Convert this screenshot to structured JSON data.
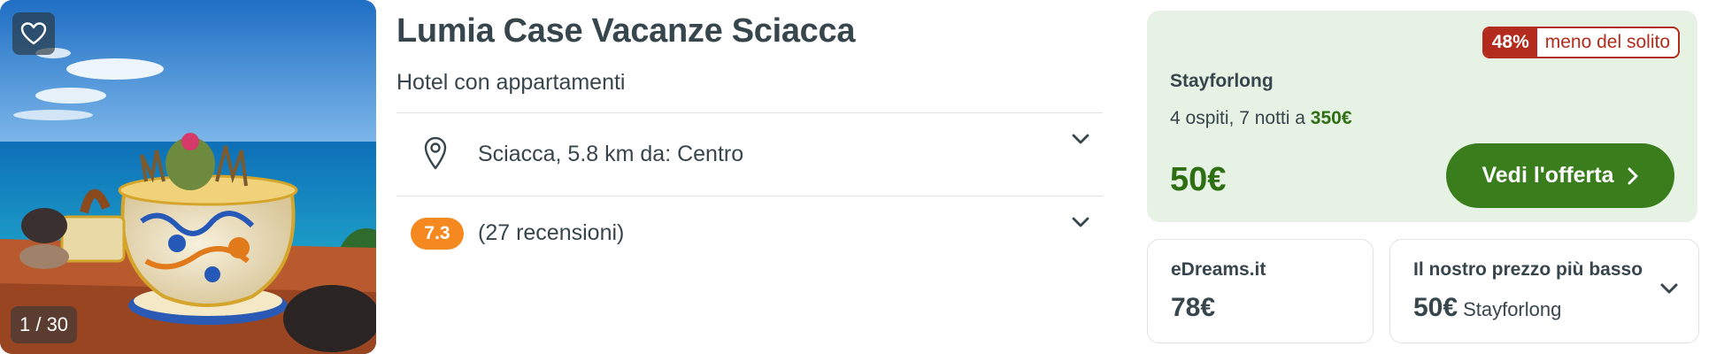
{
  "photo": {
    "counter": "1 / 30",
    "favorite_icon": "heart-outline-icon"
  },
  "hotel": {
    "name": "Lumia Case Vacanze Sciacca",
    "type": "Hotel con appartamenti",
    "location": "Sciacca, 5.8 km da: Centro",
    "rating": "7.3",
    "reviews": "(27 recensioni)"
  },
  "deal": {
    "discount_pct": "48%",
    "discount_label": "meno del solito",
    "provider": "Stayforlong",
    "stay_text": "4 ospiti, 7 notti a",
    "stay_total": "350€",
    "price": "50€",
    "cta_label": "Vedi l'offerta"
  },
  "alternatives": [
    {
      "name": "eDreams.it",
      "price": "78€",
      "sub": ""
    },
    {
      "name": "Il nostro prezzo più basso",
      "price": "50€",
      "sub": "Stayforlong"
    }
  ],
  "colors": {
    "accent_green": "#3a7d1d",
    "price_green": "#2f6f13",
    "deal_bg": "#e6f2e3",
    "discount_red": "#b32b1c",
    "rating_orange": "#f5891f",
    "text": "#37454d"
  }
}
